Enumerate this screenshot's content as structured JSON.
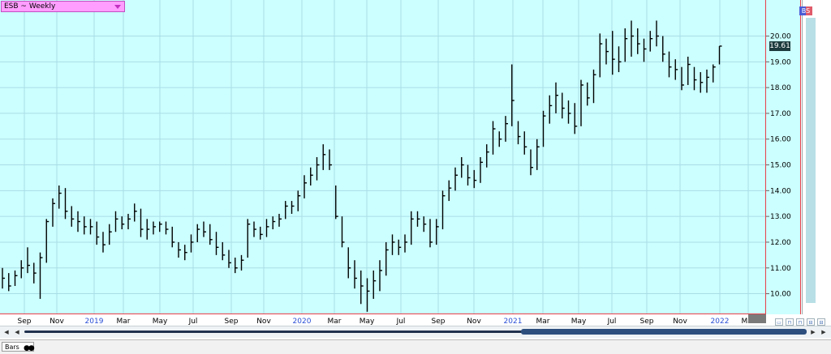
{
  "header": {
    "title": "ESB ~ Weekly"
  },
  "last_price": "19.61",
  "badge": "BS",
  "bottom_tab": {
    "label": "Bars"
  },
  "colors": {
    "background": "#ccffff",
    "grid": "#a9dde6",
    "border": "#e8404a",
    "bars": "#000000",
    "title_bg": "#ff9eff",
    "year_label": "#2a4fd6"
  },
  "chart_data": {
    "type": "bar",
    "title": "ESB ~ Weekly",
    "ylim": [
      9.2,
      21.4
    ],
    "yticks": [
      "10.00",
      "11.00",
      "12.00",
      "13.00",
      "14.00",
      "15.00",
      "16.00",
      "17.00",
      "18.00",
      "19.00",
      "20.00"
    ],
    "ytick_values": [
      10,
      11,
      12,
      13,
      14,
      15,
      16,
      17,
      18,
      19,
      20
    ],
    "x_axis_labels": [
      "Sep",
      "Nov",
      "2019",
      "Mar",
      "May",
      "Jul",
      "Sep",
      "Nov",
      "2020",
      "Mar",
      "May",
      "Jul",
      "Sep",
      "Nov",
      "2021",
      "Mar",
      "May",
      "Jul",
      "Sep",
      "Nov",
      "2022",
      "Mar"
    ],
    "x_label_years": [
      "2019",
      "2020",
      "2021",
      "2022"
    ],
    "bars": [
      [
        1,
        11.0,
        10.2,
        10.6
      ],
      [
        2,
        10.8,
        10.1,
        10.3
      ],
      [
        3,
        10.9,
        10.3,
        10.7
      ],
      [
        4,
        11.3,
        10.6,
        11.0
      ],
      [
        5,
        11.8,
        10.8,
        11.1
      ],
      [
        6,
        11.2,
        10.4,
        10.8
      ],
      [
        7,
        11.6,
        9.8,
        11.4
      ],
      [
        8,
        12.9,
        11.2,
        12.8
      ],
      [
        9,
        13.7,
        12.6,
        13.5
      ],
      [
        10,
        14.2,
        13.3,
        13.9
      ],
      [
        11,
        14.1,
        12.9,
        13.2
      ],
      [
        12,
        13.4,
        12.6,
        12.9
      ],
      [
        13,
        13.2,
        12.4,
        12.8
      ],
      [
        14,
        13.0,
        12.3,
        12.6
      ],
      [
        15,
        12.9,
        12.3,
        12.6
      ],
      [
        16,
        12.8,
        11.9,
        12.2
      ],
      [
        17,
        12.4,
        11.6,
        11.9
      ],
      [
        18,
        12.7,
        11.9,
        12.4
      ],
      [
        19,
        13.2,
        12.4,
        12.9
      ],
      [
        20,
        13.0,
        12.5,
        12.7
      ],
      [
        21,
        13.1,
        12.5,
        12.9
      ],
      [
        22,
        13.5,
        12.8,
        13.2
      ],
      [
        23,
        13.3,
        12.2,
        12.5
      ],
      [
        24,
        12.9,
        12.1,
        12.5
      ],
      [
        25,
        12.8,
        12.3,
        12.6
      ],
      [
        26,
        12.8,
        12.4,
        12.7
      ],
      [
        27,
        12.8,
        12.3,
        12.5
      ],
      [
        28,
        12.6,
        11.8,
        12.0
      ],
      [
        29,
        12.0,
        11.4,
        11.7
      ],
      [
        30,
        11.9,
        11.3,
        11.6
      ],
      [
        31,
        12.3,
        11.6,
        12.0
      ],
      [
        32,
        12.7,
        12.0,
        12.5
      ],
      [
        33,
        12.8,
        12.2,
        12.4
      ],
      [
        34,
        12.7,
        11.9,
        12.1
      ],
      [
        35,
        12.4,
        11.5,
        11.8
      ],
      [
        36,
        12.0,
        11.3,
        11.5
      ],
      [
        37,
        11.7,
        11.0,
        11.2
      ],
      [
        38,
        11.4,
        10.8,
        11.0
      ],
      [
        39,
        11.5,
        10.9,
        11.3
      ],
      [
        40,
        12.9,
        11.4,
        12.7
      ],
      [
        41,
        12.8,
        12.2,
        12.5
      ],
      [
        42,
        12.6,
        12.1,
        12.3
      ],
      [
        43,
        12.9,
        12.2,
        12.6
      ],
      [
        44,
        13.0,
        12.5,
        12.8
      ],
      [
        45,
        13.1,
        12.6,
        12.9
      ],
      [
        46,
        13.6,
        12.9,
        13.4
      ],
      [
        47,
        13.6,
        13.1,
        13.4
      ],
      [
        48,
        14.0,
        13.2,
        13.8
      ],
      [
        49,
        14.6,
        13.7,
        14.3
      ],
      [
        50,
        14.9,
        14.2,
        14.6
      ],
      [
        51,
        15.3,
        14.4,
        15.0
      ],
      [
        52,
        15.8,
        14.8,
        15.4
      ],
      [
        53,
        15.6,
        14.8,
        15.0
      ],
      [
        54,
        14.2,
        12.9,
        13.0
      ],
      [
        55,
        13.0,
        11.8,
        12.0
      ],
      [
        56,
        11.8,
        10.6,
        11.0
      ],
      [
        57,
        11.3,
        10.2,
        10.6
      ],
      [
        58,
        10.9,
        9.6,
        10.3
      ],
      [
        59,
        10.6,
        9.3,
        10.1
      ],
      [
        60,
        10.9,
        9.8,
        10.5
      ],
      [
        61,
        11.3,
        10.1,
        10.9
      ],
      [
        62,
        12.0,
        10.7,
        11.7
      ],
      [
        63,
        12.3,
        11.5,
        12.0
      ],
      [
        64,
        12.1,
        11.5,
        11.8
      ],
      [
        65,
        12.3,
        11.6,
        12.0
      ],
      [
        66,
        13.2,
        11.9,
        12.9
      ],
      [
        67,
        13.2,
        12.6,
        12.9
      ],
      [
        68,
        13.0,
        12.4,
        12.7
      ],
      [
        69,
        12.9,
        11.8,
        12.0
      ],
      [
        70,
        12.9,
        11.9,
        12.6
      ],
      [
        71,
        14.0,
        12.5,
        13.8
      ],
      [
        72,
        14.4,
        13.6,
        14.1
      ],
      [
        73,
        14.9,
        14.0,
        14.6
      ],
      [
        74,
        15.3,
        14.5,
        15.0
      ],
      [
        75,
        15.0,
        14.2,
        14.5
      ],
      [
        76,
        14.8,
        14.1,
        14.4
      ],
      [
        77,
        15.3,
        14.3,
        15.1
      ],
      [
        78,
        15.8,
        14.9,
        15.5
      ],
      [
        79,
        16.7,
        15.4,
        16.4
      ],
      [
        80,
        16.3,
        15.7,
        16.0
      ],
      [
        81,
        16.9,
        15.9,
        16.6
      ],
      [
        82,
        18.9,
        16.5,
        17.5
      ],
      [
        83,
        16.7,
        15.8,
        16.1
      ],
      [
        84,
        16.3,
        15.4,
        15.7
      ],
      [
        85,
        15.6,
        14.6,
        14.9
      ],
      [
        86,
        16.0,
        14.8,
        15.7
      ],
      [
        87,
        17.1,
        15.7,
        16.9
      ],
      [
        88,
        17.7,
        16.6,
        17.3
      ],
      [
        89,
        18.2,
        17.0,
        17.7
      ],
      [
        90,
        17.8,
        16.8,
        17.2
      ],
      [
        91,
        17.5,
        16.6,
        17.0
      ],
      [
        92,
        17.4,
        16.2,
        16.5
      ],
      [
        93,
        18.3,
        16.5,
        18.1
      ],
      [
        94,
        18.2,
        17.3,
        17.6
      ],
      [
        95,
        18.7,
        17.4,
        18.5
      ],
      [
        96,
        20.1,
        18.4,
        19.7
      ],
      [
        97,
        19.9,
        18.9,
        19.4
      ],
      [
        98,
        20.2,
        18.5,
        19.1
      ],
      [
        99,
        19.6,
        18.6,
        19.0
      ],
      [
        100,
        20.3,
        19.0,
        19.9
      ],
      [
        101,
        20.6,
        19.2,
        20.0
      ],
      [
        102,
        20.3,
        19.3,
        19.7
      ],
      [
        103,
        19.9,
        19.0,
        19.5
      ],
      [
        104,
        20.2,
        19.4,
        19.9
      ],
      [
        105,
        20.6,
        19.6,
        20.0
      ],
      [
        106,
        20.0,
        19.0,
        19.3
      ],
      [
        107,
        19.4,
        18.4,
        18.8
      ],
      [
        108,
        19.1,
        18.3,
        18.7
      ],
      [
        109,
        18.8,
        17.9,
        18.1
      ],
      [
        110,
        19.2,
        18.1,
        18.9
      ],
      [
        111,
        18.8,
        17.9,
        18.3
      ],
      [
        112,
        18.6,
        17.8,
        18.2
      ],
      [
        113,
        18.7,
        17.8,
        18.4
      ],
      [
        114,
        18.9,
        18.2,
        18.8
      ],
      [
        115,
        19.61,
        18.9,
        19.61
      ]
    ],
    "grid": true,
    "legend": "none"
  }
}
